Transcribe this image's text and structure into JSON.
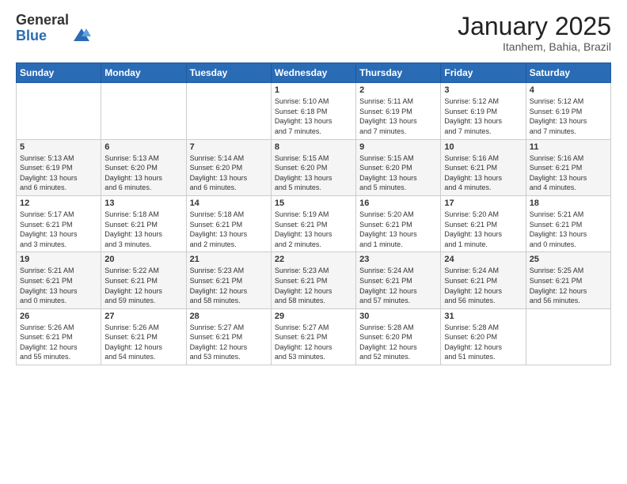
{
  "logo": {
    "general": "General",
    "blue": "Blue"
  },
  "header": {
    "month": "January 2025",
    "location": "Itanhem, Bahia, Brazil"
  },
  "days_of_week": [
    "Sunday",
    "Monday",
    "Tuesday",
    "Wednesday",
    "Thursday",
    "Friday",
    "Saturday"
  ],
  "weeks": [
    [
      {
        "day": "",
        "info": ""
      },
      {
        "day": "",
        "info": ""
      },
      {
        "day": "",
        "info": ""
      },
      {
        "day": "1",
        "info": "Sunrise: 5:10 AM\nSunset: 6:18 PM\nDaylight: 13 hours\nand 7 minutes."
      },
      {
        "day": "2",
        "info": "Sunrise: 5:11 AM\nSunset: 6:19 PM\nDaylight: 13 hours\nand 7 minutes."
      },
      {
        "day": "3",
        "info": "Sunrise: 5:12 AM\nSunset: 6:19 PM\nDaylight: 13 hours\nand 7 minutes."
      },
      {
        "day": "4",
        "info": "Sunrise: 5:12 AM\nSunset: 6:19 PM\nDaylight: 13 hours\nand 7 minutes."
      }
    ],
    [
      {
        "day": "5",
        "info": "Sunrise: 5:13 AM\nSunset: 6:19 PM\nDaylight: 13 hours\nand 6 minutes."
      },
      {
        "day": "6",
        "info": "Sunrise: 5:13 AM\nSunset: 6:20 PM\nDaylight: 13 hours\nand 6 minutes."
      },
      {
        "day": "7",
        "info": "Sunrise: 5:14 AM\nSunset: 6:20 PM\nDaylight: 13 hours\nand 6 minutes."
      },
      {
        "day": "8",
        "info": "Sunrise: 5:15 AM\nSunset: 6:20 PM\nDaylight: 13 hours\nand 5 minutes."
      },
      {
        "day": "9",
        "info": "Sunrise: 5:15 AM\nSunset: 6:20 PM\nDaylight: 13 hours\nand 5 minutes."
      },
      {
        "day": "10",
        "info": "Sunrise: 5:16 AM\nSunset: 6:21 PM\nDaylight: 13 hours\nand 4 minutes."
      },
      {
        "day": "11",
        "info": "Sunrise: 5:16 AM\nSunset: 6:21 PM\nDaylight: 13 hours\nand 4 minutes."
      }
    ],
    [
      {
        "day": "12",
        "info": "Sunrise: 5:17 AM\nSunset: 6:21 PM\nDaylight: 13 hours\nand 3 minutes."
      },
      {
        "day": "13",
        "info": "Sunrise: 5:18 AM\nSunset: 6:21 PM\nDaylight: 13 hours\nand 3 minutes."
      },
      {
        "day": "14",
        "info": "Sunrise: 5:18 AM\nSunset: 6:21 PM\nDaylight: 13 hours\nand 2 minutes."
      },
      {
        "day": "15",
        "info": "Sunrise: 5:19 AM\nSunset: 6:21 PM\nDaylight: 13 hours\nand 2 minutes."
      },
      {
        "day": "16",
        "info": "Sunrise: 5:20 AM\nSunset: 6:21 PM\nDaylight: 13 hours\nand 1 minute."
      },
      {
        "day": "17",
        "info": "Sunrise: 5:20 AM\nSunset: 6:21 PM\nDaylight: 13 hours\nand 1 minute."
      },
      {
        "day": "18",
        "info": "Sunrise: 5:21 AM\nSunset: 6:21 PM\nDaylight: 13 hours\nand 0 minutes."
      }
    ],
    [
      {
        "day": "19",
        "info": "Sunrise: 5:21 AM\nSunset: 6:21 PM\nDaylight: 13 hours\nand 0 minutes."
      },
      {
        "day": "20",
        "info": "Sunrise: 5:22 AM\nSunset: 6:21 PM\nDaylight: 12 hours\nand 59 minutes."
      },
      {
        "day": "21",
        "info": "Sunrise: 5:23 AM\nSunset: 6:21 PM\nDaylight: 12 hours\nand 58 minutes."
      },
      {
        "day": "22",
        "info": "Sunrise: 5:23 AM\nSunset: 6:21 PM\nDaylight: 12 hours\nand 58 minutes."
      },
      {
        "day": "23",
        "info": "Sunrise: 5:24 AM\nSunset: 6:21 PM\nDaylight: 12 hours\nand 57 minutes."
      },
      {
        "day": "24",
        "info": "Sunrise: 5:24 AM\nSunset: 6:21 PM\nDaylight: 12 hours\nand 56 minutes."
      },
      {
        "day": "25",
        "info": "Sunrise: 5:25 AM\nSunset: 6:21 PM\nDaylight: 12 hours\nand 56 minutes."
      }
    ],
    [
      {
        "day": "26",
        "info": "Sunrise: 5:26 AM\nSunset: 6:21 PM\nDaylight: 12 hours\nand 55 minutes."
      },
      {
        "day": "27",
        "info": "Sunrise: 5:26 AM\nSunset: 6:21 PM\nDaylight: 12 hours\nand 54 minutes."
      },
      {
        "day": "28",
        "info": "Sunrise: 5:27 AM\nSunset: 6:21 PM\nDaylight: 12 hours\nand 53 minutes."
      },
      {
        "day": "29",
        "info": "Sunrise: 5:27 AM\nSunset: 6:21 PM\nDaylight: 12 hours\nand 53 minutes."
      },
      {
        "day": "30",
        "info": "Sunrise: 5:28 AM\nSunset: 6:20 PM\nDaylight: 12 hours\nand 52 minutes."
      },
      {
        "day": "31",
        "info": "Sunrise: 5:28 AM\nSunset: 6:20 PM\nDaylight: 12 hours\nand 51 minutes."
      },
      {
        "day": "",
        "info": ""
      }
    ]
  ]
}
